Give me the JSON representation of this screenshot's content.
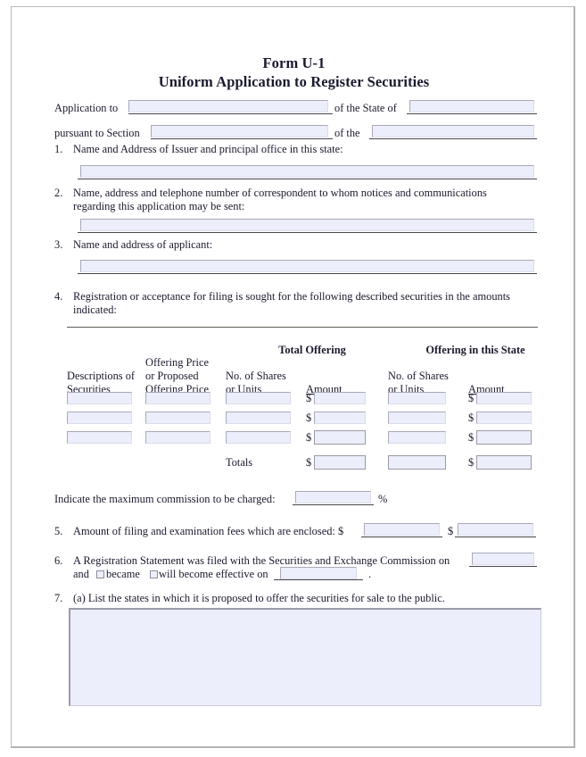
{
  "document": {
    "title_line1": "Form U-1",
    "title_line2": "Uniform Application to Register Securities"
  },
  "header_row1": {
    "label_application_to": "Application to",
    "application_to_value": "",
    "label_of_the_state_of": "of the State of",
    "state_value": ""
  },
  "header_row2": {
    "label_pursuant_to_section": "pursuant to Section",
    "section_value": "",
    "label_of_the": "of the",
    "act_value": ""
  },
  "items": [
    {
      "number": "1.",
      "text": "Name and Address of Issuer and principal office in this state:",
      "value": ""
    },
    {
      "number": "2.",
      "text_line1": "Name, address and telephone number of correspondent to whom notices and communications",
      "text_line2": "regarding this application may be sent:",
      "value": ""
    },
    {
      "number": "3.",
      "text": "Name and address of applicant:",
      "value": ""
    },
    {
      "number": "4.",
      "text_line1": "Registration or acceptance for filing is sought for the following described securities in the amounts",
      "text_line2": "indicated:"
    },
    {
      "number": "5.",
      "text": "Amount of filing and examination fees which are enclosed: $",
      "fee_value_1": "",
      "dollar_sign_2": "$",
      "fee_value_2": ""
    },
    {
      "number": "6.",
      "text_line1": "A Registration Statement was filed with the Securities and Exchange Commission on",
      "filed_date_value": "",
      "and_label": "and",
      "became_label": "became",
      "became_checked": false,
      "will_become_label": "will become effective on",
      "will_become_checked": false,
      "effective_date_value": "",
      "period": "."
    },
    {
      "number": "7.",
      "text": "(a) List the states in which it is proposed to offer the securities for sale to the public.",
      "value": ""
    }
  ],
  "securities_table": {
    "group_headers": {
      "total_offering": "Total Offering",
      "offering_in_this_state": "Offering in this State"
    },
    "column_headers": [
      {
        "line1": "",
        "line2": "Descriptions of",
        "line3": "Securities"
      },
      {
        "line1": "Offering Price",
        "line2": "or Proposed",
        "line3": "Offering Price"
      },
      {
        "line1": "",
        "line2": "No. of Shares",
        "line3": "or Units"
      },
      {
        "line1": "",
        "line2": "",
        "line3": "Amount"
      },
      {
        "line1": "",
        "line2": "No. of Shares",
        "line3": "or Units"
      },
      {
        "line1": "",
        "line2": "",
        "line3": "Amount"
      }
    ],
    "dollar_sign": "$",
    "rows": [
      {
        "description": "",
        "offering_price": "",
        "total_shares": "",
        "total_amount": "",
        "state_shares": "",
        "state_amount": ""
      },
      {
        "description": "",
        "offering_price": "",
        "total_shares": "",
        "total_amount": "",
        "state_shares": "",
        "state_amount": ""
      },
      {
        "description": "",
        "offering_price": "",
        "total_shares": "",
        "total_amount": "",
        "state_shares": "",
        "state_amount": ""
      }
    ],
    "totals_label": "Totals",
    "totals": {
      "total_amount": "",
      "state_shares": "",
      "state_amount": ""
    }
  },
  "commission": {
    "label": "Indicate the maximum commission to be charged:",
    "value": "",
    "percent_sign": "%"
  },
  "colors": {
    "field_fill": "#eceefb",
    "field_border": "#a9a9b8",
    "text": "#1a1a2e",
    "page_border": "#b3b3b3",
    "rule": "#5e5e57"
  }
}
